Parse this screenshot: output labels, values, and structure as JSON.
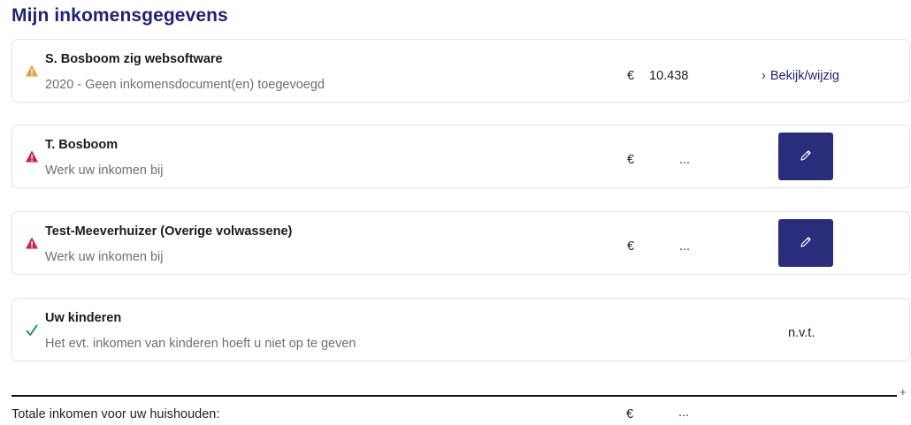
{
  "page": {
    "title": "Mijn inkomensgegevens"
  },
  "incomes": [
    {
      "name": "S. Bosboom zig websoftware",
      "subtitle": "2020 - Geen inkomensdocument(en) toegevoegd",
      "status_icon": "warning-triangle-orange",
      "currency": "€",
      "amount": "10.438",
      "action_label": "Bekijk/wijzig",
      "action_chevron": "›"
    },
    {
      "name": "T. Bosboom",
      "subtitle": "Werk uw inkomen bij",
      "status_icon": "alert-triangle-red",
      "currency": "€",
      "amount": "...",
      "action_icon": "pencil-icon"
    },
    {
      "name": "Test-Meeverhuizer (Overige volwassene)",
      "subtitle": "Werk uw inkomen bij",
      "status_icon": "alert-triangle-red",
      "currency": "€",
      "amount": "...",
      "action_icon": "pencil-icon"
    },
    {
      "name": "Uw kinderen",
      "subtitle": "Het evt. inkomen van kinderen hoeft u niet op te geven",
      "status_icon": "checkmark-green",
      "value": "n.v.t."
    }
  ],
  "divider_plus": "+",
  "total": {
    "label": "Totale inkomen voor uw huishouden:",
    "currency": "€",
    "amount": "..."
  },
  "colors": {
    "brand": "#20237a",
    "button": "#2a2c7c",
    "warning": "#e8a33b",
    "error": "#d8213a",
    "success": "#1aa06d"
  }
}
